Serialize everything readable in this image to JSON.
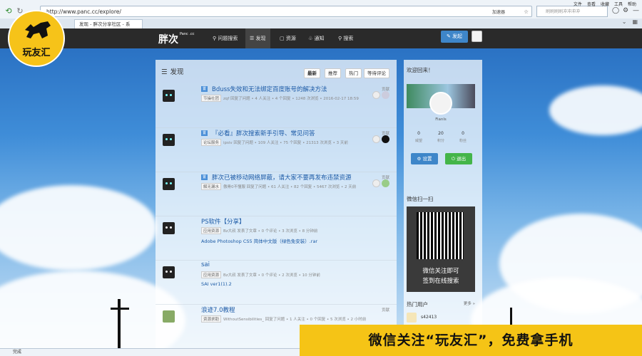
{
  "browser": {
    "url": "http://www.panc.cc/explore/",
    "accelerator": "加速器",
    "search_placeholder": "刷刷刷刷冲冲冲冲",
    "menu": [
      "文件",
      "查看",
      "收藏",
      "工具",
      "帮助"
    ],
    "tab_title": "发现 - 胖次分享社区 - 系",
    "status": "完成"
  },
  "site": {
    "logo": "胖次",
    "logo_sub": "Panc .cc",
    "nav": [
      "问题搜索",
      "发现",
      "资源",
      "通知",
      "搜索"
    ],
    "publish": "发起"
  },
  "main": {
    "title": "发现",
    "filters": [
      "最新",
      "推荐",
      "热门",
      "等待评论"
    ],
    "posts": [
      {
        "badge": "置",
        "title": "Bduss失效和无法绑定百度账号的解决方法",
        "tag": "节操社团",
        "meta": "zqf 回复了问题 • 4 人关注 • 4 个回复 • 1248 次浏览 • 2016-02-17 18:59",
        "contrib": "贡献",
        "link": ""
      },
      {
        "badge": "置",
        "title": "『必看』胖次搜索新手引导、常见问答",
        "tag": "论坛服务",
        "meta": "ipsiv 回复了问题 • 109 人关注 • 75 个回复 • 21313 次浏览 • 3 天前",
        "contrib": "贡献",
        "link": ""
      },
      {
        "badge": "置",
        "title": "胖次已被移动网络屏蔽，请大家不要再发布违禁资源",
        "tag": "解无漏水",
        "meta": "傲骨0不懂服 回复了问题 • 61 人关注 • 82 个回复 • 5467 次浏览 • 2 天前",
        "contrib": "贡献",
        "link": ""
      },
      {
        "badge": "",
        "title": "PS软件【分享】",
        "tag": "应用资源",
        "meta": "Bz大叔 发表了文章 • 0 个评论 • 3 次浏览 • 8 分钟前",
        "contrib": "",
        "link": "Adobe Photoshop CS5 简体中文版（绿色免安装）.rar"
      },
      {
        "badge": "",
        "title": "sai",
        "tag": "应用资源",
        "meta": "Bz大叔 发表了文章 • 0 个评论 • 2 次浏览 • 10 分钟前",
        "contrib": "",
        "link": "SAI ver1(1).2"
      },
      {
        "badge": "",
        "title": "浪迹7.0教程",
        "tag": "资源求助",
        "meta": "WithoutSensibilities_ 回复了问题 • 1 人关注 • 0 个回复 • 5 次浏览 • 2 小时前",
        "contrib": "贡献",
        "link": ""
      }
    ]
  },
  "sidebar": {
    "welcome": "欢迎回来！",
    "username": "Fianls",
    "stats": [
      {
        "v": "0",
        "l": "威望"
      },
      {
        "v": "20",
        "l": "积分"
      },
      {
        "v": "0",
        "l": "粉丝"
      }
    ],
    "settings": "设置",
    "exit": "退出",
    "wechat_title": "微信扫一扫",
    "qr_text1": "微信关注即可",
    "qr_text2": "签到在线搜索",
    "hot_title": "热门用户",
    "more": "更多 »",
    "hot_user": "s42413"
  },
  "overlay": {
    "watermark": "玩友汇",
    "banner": "微信关注“玩友汇”，免费拿手机"
  }
}
